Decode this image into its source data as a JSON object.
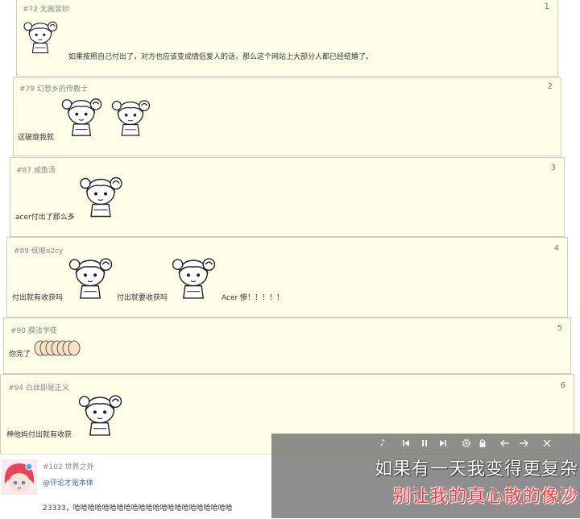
{
  "comments": [
    {
      "meta": "#72 无画皆妙",
      "num": "1",
      "text": "如果按照自己付出了，对方也应该变成情侣爱人的话，那么这个网站上大部分人都已经结婚了。"
    },
    {
      "meta": "#79 幻想乡的传教士",
      "num": "2",
      "text": "这破旋我就"
    },
    {
      "meta": "#87 咸鱼汤",
      "num": "3",
      "text": "acer付出了那么多"
    },
    {
      "meta": "#89 纸瘪o2cy",
      "num": "4",
      "text1": "付出就有收获吗",
      "text2": "付出就要收获吗",
      "text3": "Acer 惨！！！！！"
    },
    {
      "meta": "#90 膜法学徒",
      "num": "5",
      "text": "你完了"
    },
    {
      "meta": "#94 白丝即是正义",
      "num": "6",
      "text": "神他妈付出就有收获"
    }
  ],
  "bottom_comment": {
    "meta": "#102 世界之外",
    "reply": "@评论才是本体",
    "text": "23333，哈哈哈哈哈哈哈哈哈哈哈哈哈哈哈哈哈哈哈哈哈哈"
  },
  "player": {
    "icons": [
      "music-note-icon",
      "previous-icon",
      "pause-icon",
      "next-icon",
      "settings-icon",
      "lock-icon",
      "back-icon",
      "forward-icon",
      "close-icon"
    ],
    "lyric_line1": "如果有一天我变得更复杂",
    "lyric_line2": "别让我的真心散的像沙"
  }
}
